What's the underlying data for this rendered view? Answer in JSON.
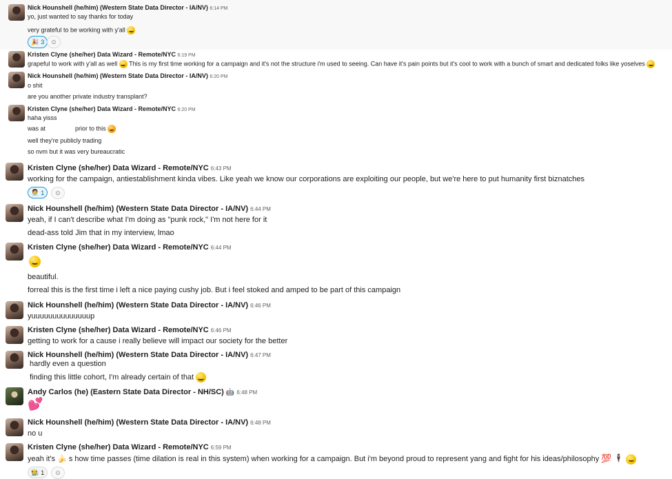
{
  "colors": {
    "name": "#1d1c1d",
    "time": "#616061",
    "highlight": "#f8f8f8",
    "accent": "#1264a3"
  },
  "toolbar": {
    "icons": [
      "emoji-reaction-icon",
      "reply-in-thread-icon",
      "share-icon",
      "bookmark-icon",
      "more-icon"
    ],
    "glyphs": [
      "☺",
      "⊡",
      "⇨",
      "☆",
      "⋯"
    ]
  },
  "messages": [
    {
      "author": "Nick Hounshell (he/him) (Western State Data Director - IA/NV)",
      "time": "6:14 PM",
      "lines": [
        "yo, just wanted to say thanks for today",
        "very grateful to be working with y'all"
      ],
      "reaction": {
        "emoji": "🎉",
        "count": "3"
      }
    },
    {
      "author": "Kristen Clyne (she/her) Data Wizard - Remote/NYC",
      "time": "6:19 PM",
      "lines": [
        "grapeful to work with y'all as well",
        "This is my first time working for a campaign and it's not the structure i'm used to seeing. Can have it's pain points but it's cool to work with a bunch of smart and dedicated folks like yoselves"
      ]
    },
    {
      "author": "Nick Hounshell (he/him) (Western State Data Director - IA/NV)",
      "time": "6:20 PM",
      "lines": [
        "o shit",
        "are you another private industry transplant?"
      ]
    },
    {
      "author": "Kristen Clyne (she/her) Data Wizard - Remote/NYC",
      "time": "6:20 PM",
      "lines": [
        "haha yisss",
        "was at",
        "prior to this",
        "well they're publicly trading",
        "so nvm but it was very bureaucratic"
      ]
    },
    {
      "author": "Kristen Clyne (she/her) Data Wizard - Remote/NYC",
      "time": "6:43 PM",
      "lines": [
        "working for the campaign, antiestablishment kinda vibes. Like yeah we know our corporations are exploiting our people, but we're here to put humanity first biznatches"
      ],
      "reaction": {
        "emoji": "🧑‍💼",
        "count": "1"
      }
    },
    {
      "author": "Nick Hounshell (he/him) (Western State Data Director - IA/NV)",
      "time": "6:44 PM",
      "lines": [
        "yeah, if I can't describe what I'm doing as \"punk rock,\" I'm not here for it",
        "dead-ass told Jim that in my interview, lmao"
      ]
    },
    {
      "author": "Kristen Clyne (she/her) Data Wizard - Remote/NYC",
      "time": "6:44 PM",
      "lines": [
        "beautiful.",
        "forreal this is the first time i left a nice paying cushy job. But i feel stoked and amped to be part of this campaign"
      ]
    },
    {
      "author": "Nick Hounshell (he/him) (Western State Data Director - IA/NV)",
      "time": "6:46 PM",
      "lines": [
        "yuuuuuuuuuuuuuup"
      ]
    },
    {
      "author": "Kristen Clyne (she/her) Data Wizard - Remote/NYC",
      "time": "6:46 PM",
      "lines": [
        "getting to work for a cause i really believe will impact our society for the better"
      ]
    },
    {
      "author": "Nick Hounshell (he/him) (Western State Data Director - IA/NV)",
      "time": "6:47 PM",
      "lines": [
        "hardly even a question",
        "finding this little cohort, I'm already certain of that"
      ]
    },
    {
      "author": "Andy Carlos (he) (Eastern State Data Director - NH/SC)",
      "time": "6:48 PM",
      "badge": "🤖",
      "lines": []
    },
    {
      "author": "Nick Hounshell (he/him) (Western State Data Director - IA/NV)",
      "time": "6:48 PM",
      "lines": [
        "no u"
      ]
    },
    {
      "author": "Kristen Clyne (she/her) Data Wizard - Remote/NYC",
      "time": "6:59 PM",
      "lines": [
        "yeah it's",
        "s how time passes (time dilation is real in this system) when working for a campaign. But i'm beyond proud to represent yang and fight for his ideas/philosophy"
      ],
      "reaction": {
        "emoji": "🧑‍🌾",
        "count": "1"
      }
    }
  ],
  "emojis": {
    "heart": "💕",
    "hundred": "💯",
    "person": "🕴",
    "banana": "🍌",
    "robot": "🤖"
  }
}
